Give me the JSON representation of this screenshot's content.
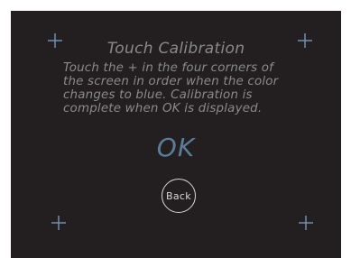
{
  "screen": {
    "title": "Touch Calibration",
    "instructions": "Touch the + in the four corners of\nthe screen in order when the color\nchanges to blue. Calibration is\ncomplete when OK is displayed.",
    "status_label": "OK",
    "back_label": "Back"
  },
  "icons": {
    "crosshair": "plus-crosshair-icon"
  },
  "colors": {
    "background": "#231f20",
    "text": "#8a8a8a",
    "crosshair": "#6f90ad",
    "ok": "#5a7d99",
    "button": "#d8d8d8"
  }
}
